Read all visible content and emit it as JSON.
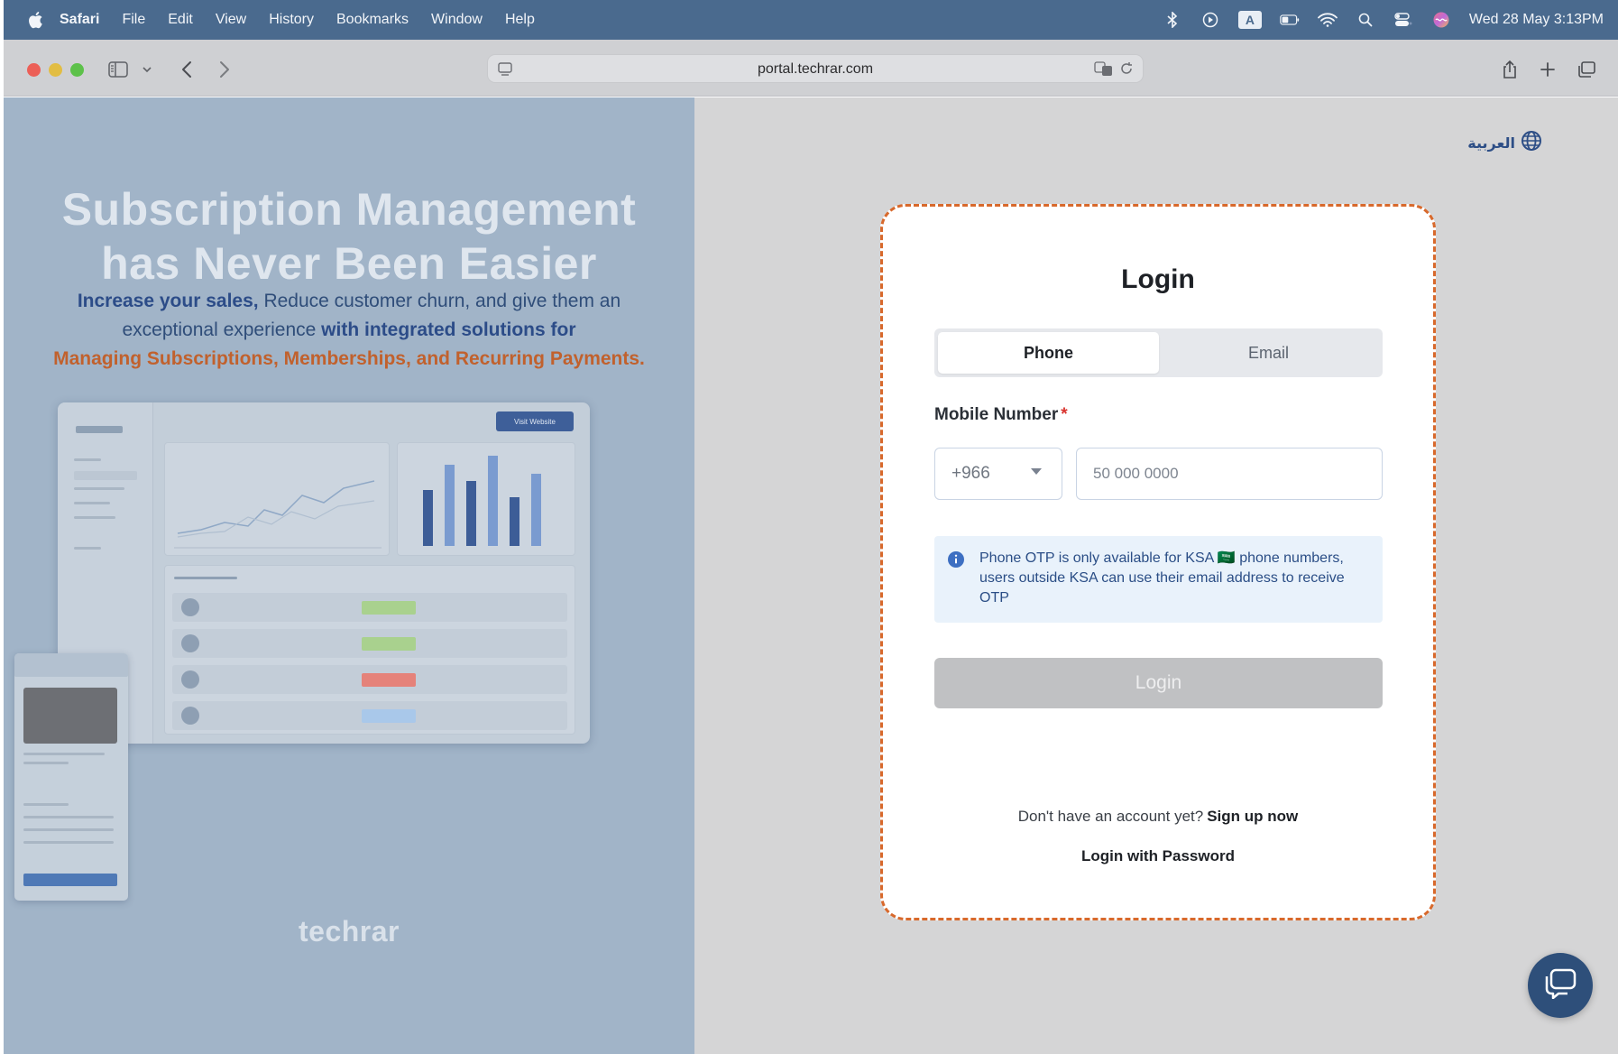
{
  "menubar": {
    "app_name": "Safari",
    "items": [
      "File",
      "Edit",
      "View",
      "History",
      "Bookmarks",
      "Window",
      "Help"
    ],
    "datetime": "Wed 28 May  3:13PM",
    "input_source": "A"
  },
  "browser": {
    "url": "portal.techrar.com"
  },
  "hero": {
    "title_line1": "Subscription Management",
    "title_line2": "has Never Been Easier",
    "sub_bold1": "Increase your sales,",
    "sub_text1": " Reduce customer churn, and give them an",
    "sub_text2": "exceptional experience ",
    "sub_bold2": "with integrated solutions for",
    "sub_orange": "Managing  Subscriptions, Memberships, and Recurring Payments.",
    "mock_button": "Visit Website",
    "brand": "techrar"
  },
  "language": {
    "label": "العربية"
  },
  "login": {
    "title": "Login",
    "tabs": [
      "Phone",
      "Email"
    ],
    "active_tab": "Phone",
    "mobile_label": "Mobile Number",
    "required_mark": "*",
    "country_code": "+966",
    "phone_placeholder": "50 000 0000",
    "info_text": "Phone OTP is only available for KSA 🇸🇦 phone numbers, users outside KSA can use their email address to receive OTP",
    "submit_label": "Login",
    "no_account_text": "Don't have an account yet?",
    "signup_link": "Sign up now",
    "password_link": "Login with Password"
  },
  "colors": {
    "card_border": "#d8692c",
    "primary_text": "#2d4e86",
    "hero_bg": "#a1b4c8",
    "accent_orange": "#c1612d"
  }
}
